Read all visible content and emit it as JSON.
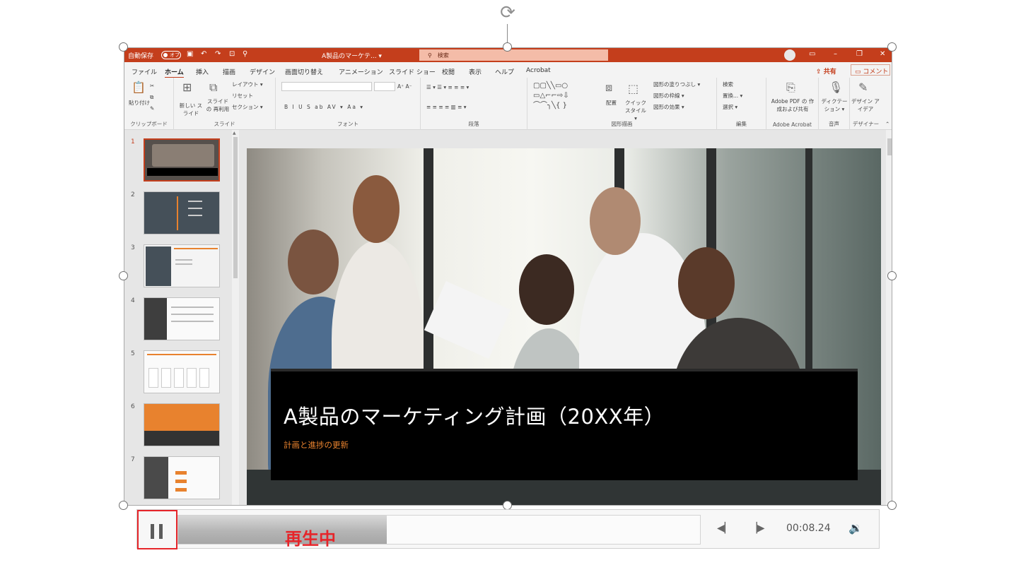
{
  "window": {
    "autosave": "自動保存",
    "autosave_state": "オフ",
    "doc_title": "A製品のマーケテ... ▾",
    "search_placeholder": "検索"
  },
  "tabs": [
    "ファイル",
    "ホーム",
    "挿入",
    "描画",
    "デザイン",
    "画面切り替え",
    "アニメーション",
    "スライド ショー",
    "校閲",
    "表示",
    "ヘルプ",
    "Acrobat"
  ],
  "active_tab": "ホーム",
  "share_label": "共有",
  "comment_label": "コメント",
  "ribbon": {
    "clipboard": {
      "paste": "貼り付け",
      "label": "クリップボード"
    },
    "slides": {
      "new_slide": "新しい スライド",
      "reuse": "スライドの 再利用",
      "layout": "レイアウト ▾",
      "reset": "リセット",
      "section": "セクション ▾",
      "label": "スライド"
    },
    "font": {
      "label": "フォント",
      "styles": "B  I  U  S  ab  AV ▾  Aa ▾"
    },
    "paragraph": {
      "label": "段落"
    },
    "drawing": {
      "label": "図形描画",
      "arrange": "配置",
      "quick": "クイック スタイル ▾",
      "fill": "図形の塗りつぶし ▾",
      "outline": "図形の枠線 ▾",
      "effect": "図形の効果 ▾"
    },
    "editing": {
      "label": "編集",
      "find": "検索",
      "replace": "置換... ▾",
      "select": "選択 ▾"
    },
    "acrobat": {
      "label": "Adobe Acrobat",
      "text": "Adobe PDF の 作成および共有"
    },
    "voice": {
      "label": "音声",
      "text": "ディクテー ション ▾"
    },
    "designer": {
      "label": "デザイナー",
      "text": "デザイン アイデア"
    }
  },
  "thumbnails": [
    "1",
    "2",
    "3",
    "4",
    "5",
    "6",
    "7"
  ],
  "selected_slide": "1",
  "slide": {
    "title": "A製品のマーケティング計画（20XX年）",
    "subtitle": "計画と進捗の更新"
  },
  "player": {
    "status": "再生中",
    "progress": 0.4,
    "time": "00:08.24",
    "accent": "#e6252a"
  },
  "colors": {
    "titlebar": "#c43e1c",
    "accent_orange": "#e8822e"
  }
}
